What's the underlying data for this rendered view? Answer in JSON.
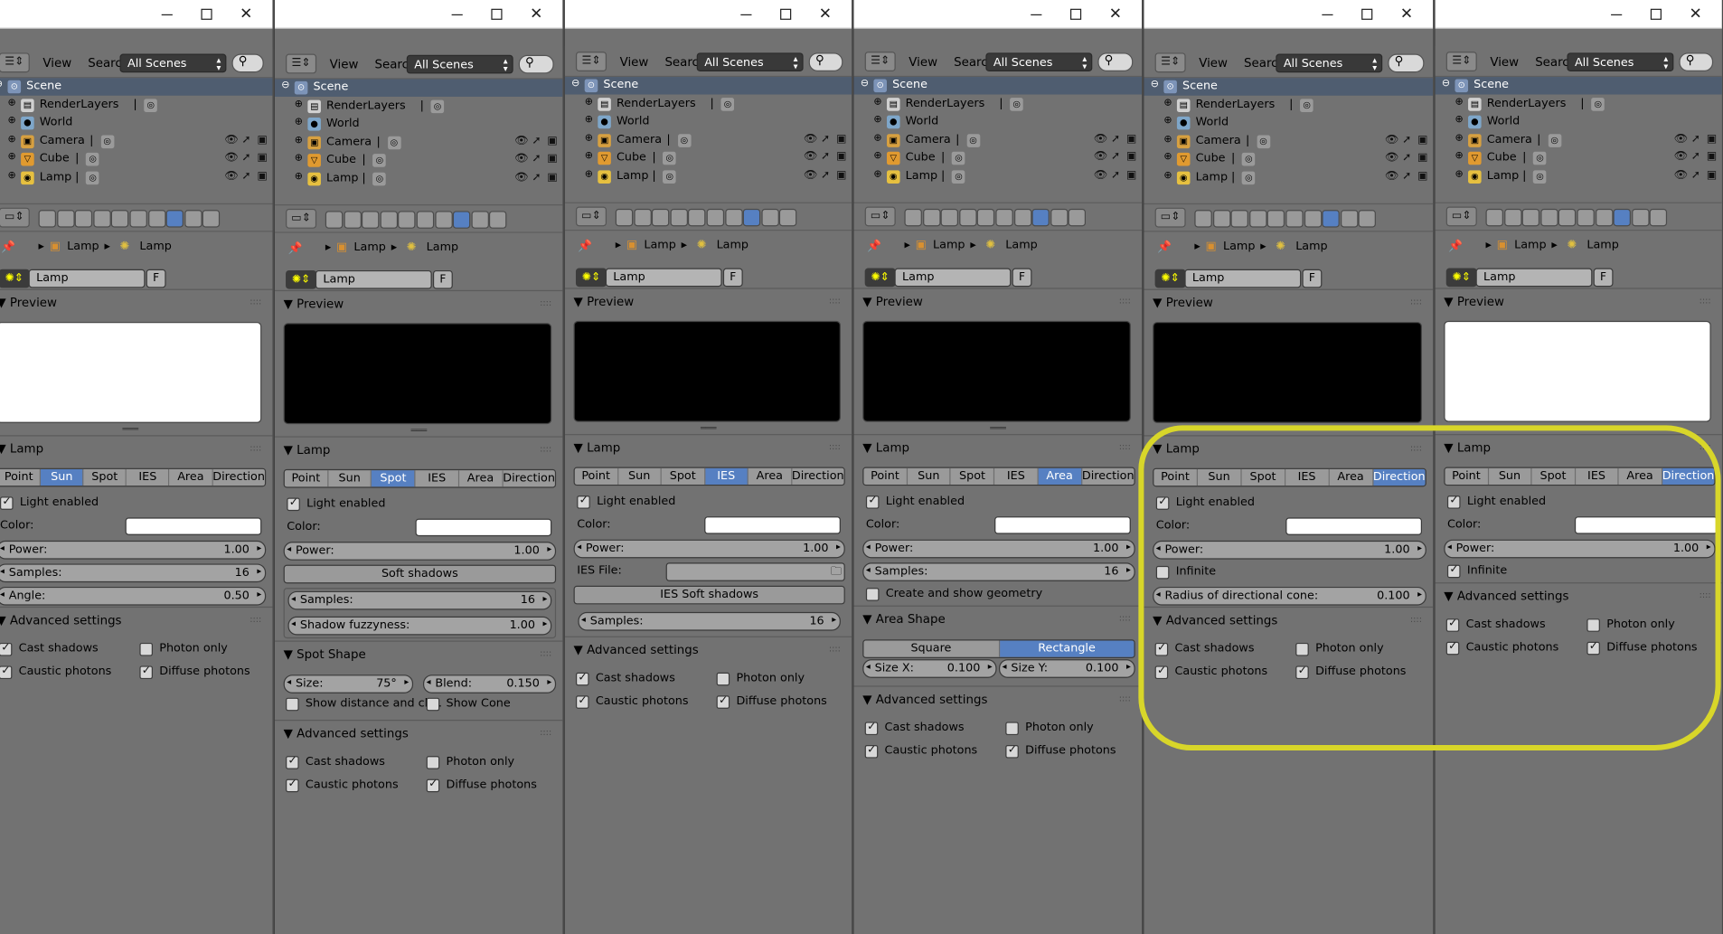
{
  "window": {
    "minimize_icon": "minimize-icon",
    "maximize_icon": "maximize-icon",
    "close_icon": "close-icon",
    "close_glyph": "✕"
  },
  "header": {
    "view": "View",
    "search": "Search",
    "scenes": "All Scenes"
  },
  "outliner": [
    "Scene",
    "RenderLayers",
    "World",
    "Camera",
    "Cube",
    "Lamp"
  ],
  "breadcrumb": {
    "object": "Lamp",
    "data": "Lamp"
  },
  "datablock": {
    "name": "Lamp",
    "fake_user": "F"
  },
  "sections": {
    "preview": "Preview",
    "lamp": "Lamp",
    "advanced": "Advanced settings",
    "spot_shape": "Spot Shape",
    "area_shape": "Area Shape"
  },
  "lamp_types": [
    "Point",
    "Sun",
    "Spot",
    "IES",
    "Area",
    "Direction"
  ],
  "labels": {
    "light_enabled": "Light enabled",
    "color": "Color:",
    "power": "Power:",
    "samples": "Samples:",
    "angle": "Angle:",
    "soft_shadows": "Soft shadows",
    "shadow_fuzzyness": "Shadow fuzzyness:",
    "size": "Size:",
    "blend": "Blend:",
    "show_distance": "Show distance and cli...",
    "show_cone": "Show Cone",
    "ies_file": "IES File:",
    "ies_soft_shadows": "IES Soft shadows",
    "create_geometry": "Create and show geometry",
    "square": "Square",
    "rectangle": "Rectangle",
    "size_x": "Size X:",
    "size_y": "Size Y:",
    "infinite": "Infinite",
    "radius_cone": "Radius of directional cone:",
    "cast_shadows": "Cast shadows",
    "photon_only": "Photon only",
    "caustic_photons": "Caustic photons",
    "diffuse_photons": "Diffuse photons"
  },
  "values": {
    "power": "1.00",
    "samples_16": "16",
    "angle": "0.50",
    "spot_size": "75°",
    "blend": "0.150",
    "size_x": "0.100",
    "size_y": "0.100",
    "radius_cone": "0.100"
  },
  "panels": [
    {
      "active_type": "Sun",
      "preview_color": "#ffffff"
    },
    {
      "active_type": "Spot",
      "preview_color": "#000000"
    },
    {
      "active_type": "IES",
      "preview_color": "#000000"
    },
    {
      "active_type": "Area",
      "preview_color": "#000000"
    },
    {
      "active_type": "Direction",
      "preview_color": "#000000"
    },
    {
      "active_type": "Direction",
      "preview_color": "#ffffff"
    }
  ],
  "colors": {
    "accent": "#5680c2",
    "background": "#727272",
    "highlight": "#d8d62a"
  }
}
